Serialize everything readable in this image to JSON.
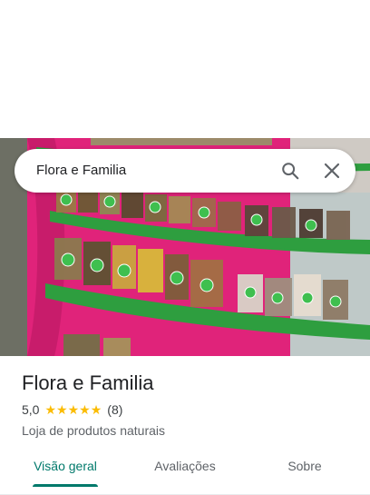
{
  "search": {
    "query": "Flora e Familia"
  },
  "place": {
    "name": "Flora e Familia",
    "rating": "5,0",
    "stars": 5,
    "review_count": "(8)",
    "category": "Loja de produtos naturais"
  },
  "tabs": [
    {
      "label": "Visão geral",
      "active": true
    },
    {
      "label": "Avaliações",
      "active": false
    },
    {
      "label": "Sobre",
      "active": false
    }
  ],
  "colors": {
    "accent": "#00796b",
    "star": "#fbbc04",
    "wall": "#e0237a",
    "shelf": "#2e9e3f"
  },
  "icons": {
    "search": "search-icon",
    "close": "close-icon",
    "star": "star-icon"
  }
}
